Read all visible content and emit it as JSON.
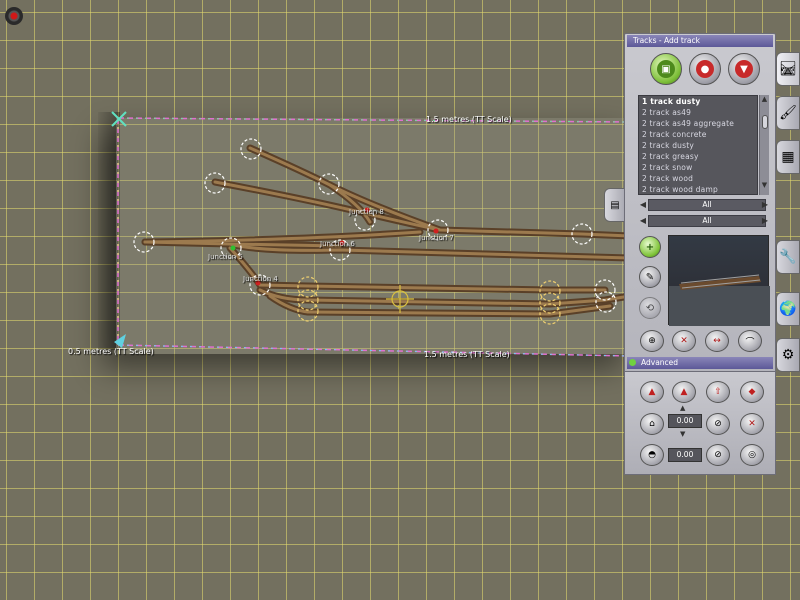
{
  "board": {
    "top_dimension": "1.5 metres  (TT Scale)",
    "left_dimension": "0.5 metres  (TT Scale)",
    "bottom_dimension": "1.5 metres  (TT Scale)"
  },
  "junctions": [
    {
      "label": "Junction 8"
    },
    {
      "label": "Junction 7"
    },
    {
      "label": "Junction 6"
    },
    {
      "label": "Junction 5"
    },
    {
      "label": "Junction 4"
    }
  ],
  "panel": {
    "title": "Tracks - Add track",
    "mode_buttons": [
      {
        "icon": "add-track-icon",
        "active": true
      },
      {
        "icon": "track-spline-icon",
        "active": false
      },
      {
        "icon": "track-height-icon",
        "active": false
      }
    ],
    "track_list": [
      {
        "label": "1 track dusty",
        "selected": true
      },
      {
        "label": "2 track as49",
        "selected": false
      },
      {
        "label": "2 track as49 aggregate",
        "selected": false
      },
      {
        "label": "2 track concrete",
        "selected": false
      },
      {
        "label": "2 track dusty",
        "selected": false
      },
      {
        "label": "2 track greasy",
        "selected": false
      },
      {
        "label": "2 track snow",
        "selected": false
      },
      {
        "label": "2 track wood",
        "selected": false
      },
      {
        "label": "2 track wood damp",
        "selected": false
      }
    ],
    "filter_1": "All",
    "filter_2": "All",
    "advanced_label": "Advanced",
    "height_value": "0.00",
    "grade_value": "0.00"
  },
  "colors": {
    "grid_line": "#e6dc6e",
    "ground": "#73705f",
    "track": "#7a5a3a",
    "panel_title": "#5c5898",
    "active_green": "#7fc03a"
  }
}
